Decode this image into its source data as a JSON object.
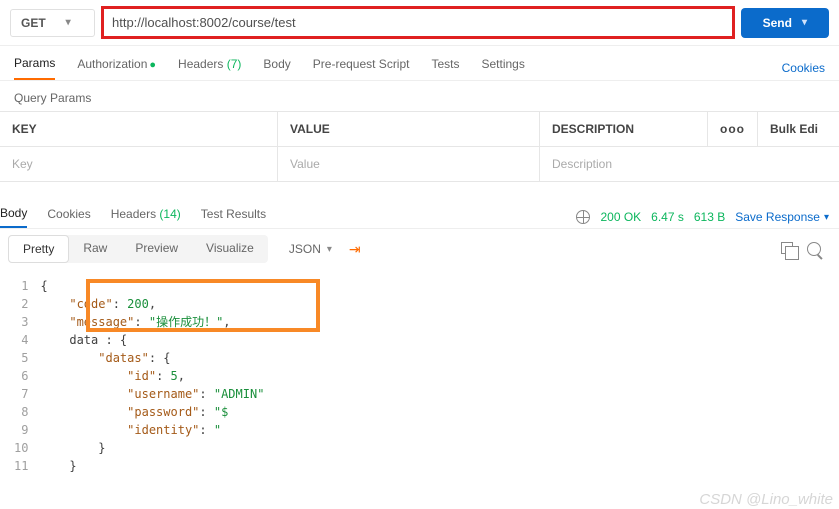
{
  "request": {
    "method": "GET",
    "url": "http://localhost:8002/course/test",
    "send_label": "Send"
  },
  "tabs": {
    "params": "Params",
    "authorization": "Authorization",
    "headers": "Headers",
    "headers_count": "(7)",
    "body": "Body",
    "prerequest": "Pre-request Script",
    "tests": "Tests",
    "settings": "Settings",
    "cookies": "Cookies"
  },
  "query_params": {
    "title": "Query Params",
    "headers": {
      "key": "KEY",
      "value": "VALUE",
      "description": "DESCRIPTION",
      "bulk": "Bulk Edi"
    },
    "placeholders": {
      "key": "Key",
      "value": "Value",
      "description": "Description"
    },
    "more": "ooo"
  },
  "response_tabs": {
    "body": "Body",
    "cookies": "Cookies",
    "headers": "Headers",
    "headers_count": "(14)",
    "test_results": "Test Results"
  },
  "status": {
    "code_text": "200 OK",
    "time": "6.47 s",
    "size": "613 B",
    "save_response": "Save Response"
  },
  "view_tabs": {
    "pretty": "Pretty",
    "raw": "Raw",
    "preview": "Preview",
    "visualize": "Visualize",
    "format": "JSON"
  },
  "code_lines": [
    {
      "n": "1",
      "indent": 0,
      "hasFold": true,
      "parts": [
        {
          "t": "brace",
          "v": "{"
        }
      ]
    },
    {
      "n": "2",
      "indent": 1,
      "parts": [
        {
          "t": "key",
          "v": "\"code\""
        },
        {
          "t": "plain",
          "v": ": "
        },
        {
          "t": "num",
          "v": "200"
        },
        {
          "t": "plain",
          "v": ","
        }
      ]
    },
    {
      "n": "3",
      "indent": 1,
      "parts": [
        {
          "t": "key",
          "v": "\"message\""
        },
        {
          "t": "plain",
          "v": ": "
        },
        {
          "t": "str",
          "v": "\"操作成功！\""
        },
        {
          "t": "plain",
          "v": ","
        }
      ]
    },
    {
      "n": "4",
      "indent": 1,
      "parts": [
        {
          "t": "plain",
          "v": "data : {"
        }
      ]
    },
    {
      "n": "5",
      "indent": 2,
      "parts": [
        {
          "t": "key",
          "v": "\"datas\""
        },
        {
          "t": "plain",
          "v": ": "
        },
        {
          "t": "brace",
          "v": "{"
        }
      ]
    },
    {
      "n": "6",
      "indent": 3,
      "parts": [
        {
          "t": "key",
          "v": "\"id\""
        },
        {
          "t": "plain",
          "v": ": "
        },
        {
          "t": "num",
          "v": "5"
        },
        {
          "t": "plain",
          "v": ","
        }
      ]
    },
    {
      "n": "7",
      "indent": 3,
      "parts": [
        {
          "t": "key",
          "v": "\"username\""
        },
        {
          "t": "plain",
          "v": ": "
        },
        {
          "t": "str",
          "v": "\"ADMIN\""
        }
      ]
    },
    {
      "n": "8",
      "indent": 3,
      "parts": [
        {
          "t": "key",
          "v": "\"password\""
        },
        {
          "t": "plain",
          "v": ": "
        },
        {
          "t": "str",
          "v": "\"$   "
        }
      ]
    },
    {
      "n": "9",
      "indent": 3,
      "parts": [
        {
          "t": "key",
          "v": "\"identity\""
        },
        {
          "t": "plain",
          "v": ": "
        },
        {
          "t": "str",
          "v": "\""
        }
      ]
    },
    {
      "n": "10",
      "indent": 2,
      "parts": [
        {
          "t": "brace",
          "v": "}"
        }
      ]
    },
    {
      "n": "11",
      "indent": 1,
      "parts": [
        {
          "t": "brace",
          "v": "}"
        }
      ]
    }
  ],
  "watermark": "CSDN @Lino_white"
}
